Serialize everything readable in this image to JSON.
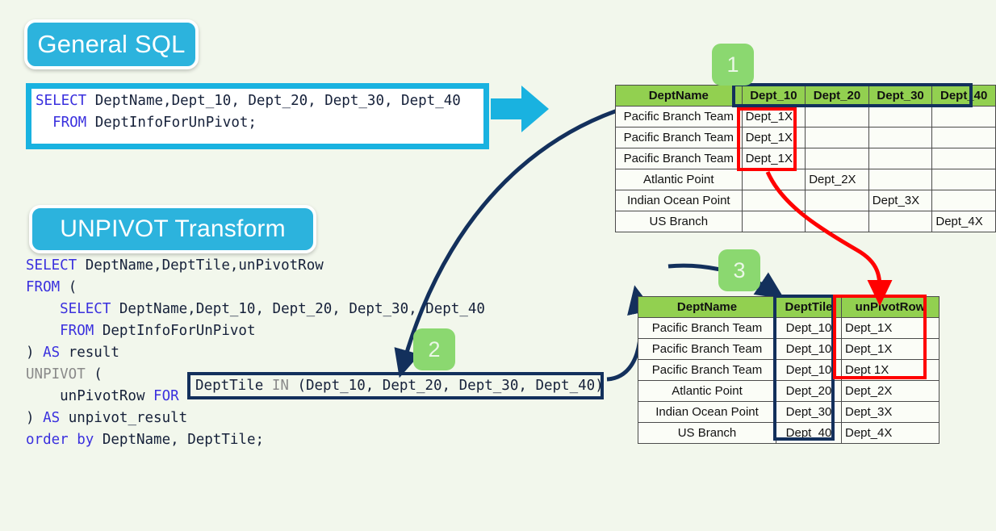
{
  "page": {
    "background_color": "#F2F7EC",
    "accent_cyan": "#2CB3DD",
    "accent_navy": "#13305C",
    "accent_red": "#FF0000",
    "accent_green_header": "#92D050",
    "accent_green_badge": "#8BD870"
  },
  "sections": {
    "general_sql": {
      "title": "General SQL",
      "code_lines": [
        {
          "parts": [
            {
              "t": "SELECT",
              "c": "kw"
            },
            {
              "t": " DeptName,Dept_10, Dept_20, Dept_30, Dept_40",
              "c": "id"
            }
          ]
        },
        {
          "parts": [
            {
              "t": "  FROM",
              "c": "kw"
            },
            {
              "t": " DeptInfoForUnPivot;",
              "c": "id"
            }
          ]
        }
      ]
    },
    "unpivot_transform": {
      "title": "UNPIVOT Transform",
      "code_lines": [
        {
          "parts": [
            {
              "t": "SELECT",
              "c": "kw"
            },
            {
              "t": " DeptName,DeptTile,unPivotRow",
              "c": "id"
            }
          ]
        },
        {
          "parts": [
            {
              "t": "FROM",
              "c": "kw"
            },
            {
              "t": " (",
              "c": "id"
            }
          ]
        },
        {
          "parts": [
            {
              "t": "    SELECT",
              "c": "kw"
            },
            {
              "t": " DeptName,Dept_10, Dept_20, Dept_30, Dept_40",
              "c": "id"
            }
          ]
        },
        {
          "parts": [
            {
              "t": "    FROM",
              "c": "kw"
            },
            {
              "t": " DeptInfoForUnPivot",
              "c": "id"
            }
          ]
        },
        {
          "parts": [
            {
              "t": ") ",
              "c": "id"
            },
            {
              "t": "AS",
              "c": "kw"
            },
            {
              "t": " result",
              "c": "id"
            }
          ]
        },
        {
          "parts": [
            {
              "t": "UNPIVOT",
              "c": "kw2"
            },
            {
              "t": " (",
              "c": "id"
            }
          ]
        },
        {
          "parts": [
            {
              "t": "    unPivotRow ",
              "c": "id"
            },
            {
              "t": "FOR",
              "c": "kw"
            },
            {
              "t": " ",
              "c": "id"
            }
          ]
        },
        {
          "parts": [
            {
              "t": ") ",
              "c": "id"
            },
            {
              "t": "AS",
              "c": "kw"
            },
            {
              "t": " unpivot_result",
              "c": "id"
            }
          ]
        },
        {
          "parts": [
            {
              "t": "order by",
              "c": "kw"
            },
            {
              "t": " DeptName, DeptTile;",
              "c": "id"
            }
          ]
        }
      ],
      "highlighted_fragment": {
        "parts": [
          {
            "t": "DeptTile ",
            "c": "id"
          },
          {
            "t": "IN",
            "c": "kw2"
          },
          {
            "t": " (Dept_10, Dept_20, Dept_30, Dept_40)",
            "c": "id"
          }
        ]
      }
    }
  },
  "steps": [
    {
      "id": "step1",
      "label": "1"
    },
    {
      "id": "step2",
      "label": "2"
    },
    {
      "id": "step3",
      "label": "3"
    }
  ],
  "source_table": {
    "name": "DeptInfoForUnPivot",
    "headers": [
      "DeptName",
      "Dept_10",
      "Dept_20",
      "Dept_30",
      "Dept_40"
    ],
    "rows": [
      [
        "Pacific Branch Team",
        "Dept_1X",
        "",
        "",
        ""
      ],
      [
        "Pacific Branch Team",
        "Dept_1X",
        "",
        "",
        ""
      ],
      [
        "Pacific Branch Team",
        "Dept_1X",
        "",
        "",
        ""
      ],
      [
        "Atlantic Point",
        "",
        "Dept_2X",
        "",
        ""
      ],
      [
        "Indian Ocean Point",
        "",
        "",
        "Dept_3X",
        ""
      ],
      [
        "US Branch",
        "",
        "",
        "",
        "Dept_4X"
      ]
    ]
  },
  "result_table": {
    "name": "unpivot_result",
    "headers": [
      "DeptName",
      "DeptTile",
      "unPivotRow"
    ],
    "rows": [
      [
        "Pacific Branch Team",
        "Dept_10",
        "Dept_1X"
      ],
      [
        "Pacific Branch Team",
        "Dept_10",
        "Dept_1X"
      ],
      [
        "Pacific Branch Team",
        "Dept_10",
        "Dept 1X"
      ],
      [
        "Atlantic Point",
        "Dept_20",
        "Dept_2X"
      ],
      [
        "Indian Ocean Point",
        "Dept_30",
        "Dept_3X"
      ],
      [
        "US Branch",
        "Dept_40",
        "Dept_4X"
      ]
    ]
  },
  "annotations": {
    "cyan_arrow": "arrow-right-icon",
    "curve_source_to_fragment": "curved-arrow-icon",
    "curve_step3_to_result": "curved-arrow-icon",
    "curve_fragment_to_result": "curved-arrow-icon",
    "red_curve_col_to_unpivotrow": "red-curved-arrow-icon"
  }
}
